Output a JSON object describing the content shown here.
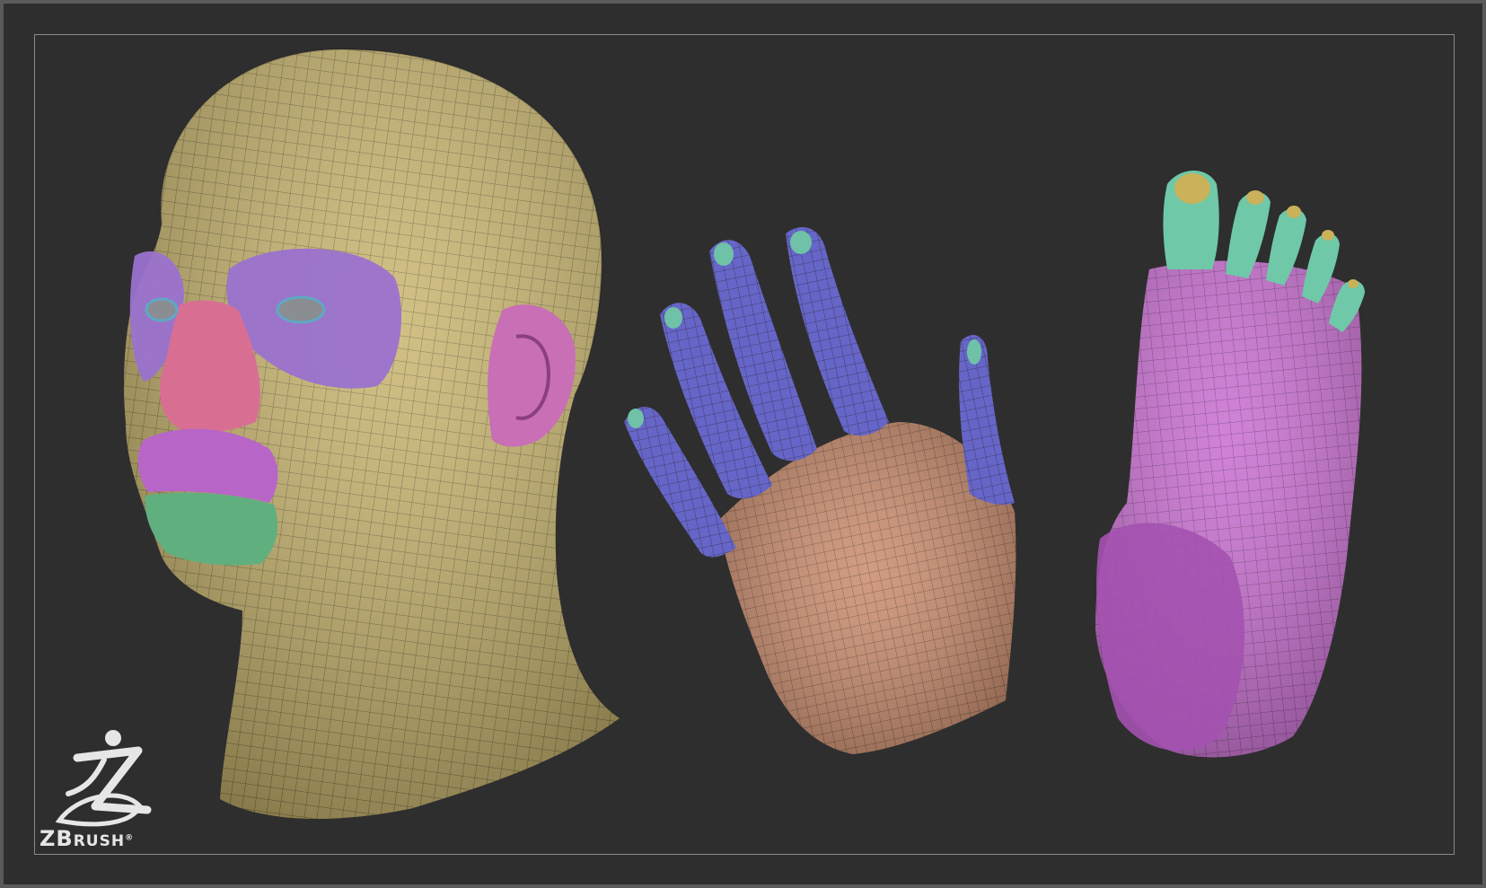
{
  "brand": {
    "logo_icon": "zbrush-runner-logo",
    "name_big": "ZB",
    "name_small": "RUSH",
    "registered": "®"
  },
  "colors": {
    "background": "#2e2e2e",
    "frame": "#8a8a8a",
    "head_base": "#c7b36a",
    "eye_region": "#9a72cf",
    "nose_region": "#d86f93",
    "lip_upper": "#b766c8",
    "lip_lower": "#5fb07e",
    "ear": "#c86fb5",
    "hand_base": "#c98a6a",
    "finger": "#6666c8",
    "fingernail": "#6fc2a8",
    "foot_base": "#c86cd0",
    "toe": "#6fc8a8",
    "toenail": "#c9b25a"
  },
  "models": [
    {
      "name": "head-model"
    },
    {
      "name": "hand-model"
    },
    {
      "name": "foot-model"
    }
  ]
}
